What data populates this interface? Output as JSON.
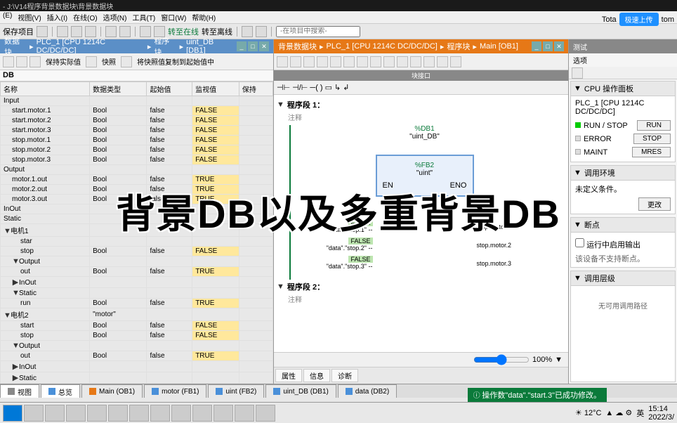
{
  "title": "- J:\\V14程序背景数据块\\背景数据块",
  "menu": [
    "(E)",
    "视图(V)",
    "插入(I)",
    "在线(O)",
    "选项(N)",
    "工具(T)",
    "窗口(W)",
    "帮助(H)"
  ],
  "toolbar": {
    "save": "保存项目",
    "goto_online": "转至在线",
    "goto_offline": "转至离线",
    "search_ph": "-在项目中搜索-"
  },
  "topright": {
    "total": "Tota",
    "cloud": "极速上传",
    "tom": "tom"
  },
  "left": {
    "crumb": [
      "数据块",
      "PLC_1 [CPU 1214C DC/DC/DC]",
      "程序块",
      "uint_DB [DB1]"
    ],
    "tb": {
      "keep": "保持实际值",
      "snap": "快照",
      "copy": "将快照值复制到起始值中"
    },
    "db_name": "DB",
    "cols": [
      "名称",
      "数据类型",
      "起始值",
      "监视值",
      "保持"
    ],
    "rows": [
      {
        "n": "Input",
        "t": "",
        "s": "",
        "m": "",
        "lvl": 0
      },
      {
        "n": "start.motor.1",
        "t": "Bool",
        "s": "false",
        "m": "FALSE",
        "lvl": 1
      },
      {
        "n": "start.motor.2",
        "t": "Bool",
        "s": "false",
        "m": "FALSE",
        "lvl": 1
      },
      {
        "n": "start.motor.3",
        "t": "Bool",
        "s": "false",
        "m": "FALSE",
        "lvl": 1
      },
      {
        "n": "stop.motor.1",
        "t": "Bool",
        "s": "false",
        "m": "FALSE",
        "lvl": 1
      },
      {
        "n": "stop.motor.2",
        "t": "Bool",
        "s": "false",
        "m": "FALSE",
        "lvl": 1
      },
      {
        "n": "stop.motor.3",
        "t": "Bool",
        "s": "false",
        "m": "FALSE",
        "lvl": 1
      },
      {
        "n": "Output",
        "t": "",
        "s": "",
        "m": "",
        "lvl": 0
      },
      {
        "n": "motor.1.out",
        "t": "Bool",
        "s": "false",
        "m": "TRUE",
        "lvl": 1
      },
      {
        "n": "motor.2.out",
        "t": "Bool",
        "s": "false",
        "m": "TRUE",
        "lvl": 1
      },
      {
        "n": "motor.3.out",
        "t": "Bool",
        "s": "false",
        "m": "TRUE",
        "lvl": 1
      },
      {
        "n": "InOut",
        "t": "",
        "s": "",
        "m": "",
        "lvl": 0
      },
      {
        "n": "Static",
        "t": "",
        "s": "",
        "m": "",
        "lvl": 0
      },
      {
        "n": "电机1",
        "t": "",
        "s": "",
        "m": "",
        "lvl": 0,
        "exp": "▼"
      },
      {
        "n": "star",
        "t": "",
        "s": "",
        "m": "",
        "lvl": 2
      },
      {
        "n": "stop",
        "t": "Bool",
        "s": "false",
        "m": "FALSE",
        "lvl": 2
      },
      {
        "n": "Output",
        "t": "",
        "s": "",
        "m": "",
        "lvl": 1,
        "exp": "▼"
      },
      {
        "n": "out",
        "t": "Bool",
        "s": "false",
        "m": "TRUE",
        "lvl": 2
      },
      {
        "n": "InOut",
        "t": "",
        "s": "",
        "m": "",
        "lvl": 1,
        "exp": "▶"
      },
      {
        "n": "Static",
        "t": "",
        "s": "",
        "m": "",
        "lvl": 1,
        "exp": "▼"
      },
      {
        "n": "run",
        "t": "Bool",
        "s": "false",
        "m": "TRUE",
        "lvl": 2
      },
      {
        "n": "电机2",
        "t": "\"motor\"",
        "s": "",
        "m": "",
        "lvl": 0,
        "exp": "▼"
      },
      {
        "n": "start",
        "t": "Bool",
        "s": "false",
        "m": "FALSE",
        "lvl": 2
      },
      {
        "n": "stop",
        "t": "Bool",
        "s": "false",
        "m": "FALSE",
        "lvl": 2
      },
      {
        "n": "Output",
        "t": "",
        "s": "",
        "m": "",
        "lvl": 1,
        "exp": "▼"
      },
      {
        "n": "out",
        "t": "Bool",
        "s": "false",
        "m": "TRUE",
        "lvl": 2
      },
      {
        "n": "InOut",
        "t": "",
        "s": "",
        "m": "",
        "lvl": 1,
        "exp": "▶"
      },
      {
        "n": "Static",
        "t": "",
        "s": "",
        "m": "",
        "lvl": 1,
        "exp": "▶"
      }
    ]
  },
  "mid": {
    "crumb": [
      "背景数据块",
      "PLC_1 [CPU 1214C DC/DC/DC]",
      "程序块",
      "Main [OB1]"
    ],
    "net1": "程序段 1：",
    "net2": "程序段 2：",
    "comment": "注释",
    "db_inst": "%DB1",
    "db_name": "\"uint_DB\"",
    "fb_inst": "%FB2",
    "fb_name": "\"uint\"",
    "en": "EN",
    "eno": "ENO",
    "pins": [
      {
        "l": "\"data\".\"stop.1\"",
        "v": "FALSE",
        "r": "stop.motor.1"
      },
      {
        "l": "\"data\".\"stop.2\"",
        "v": "FALSE",
        "r": "stop.motor.2"
      },
      {
        "l": "\"data\".\"stop.3\"",
        "v": "FALSE",
        "r": "stop.motor.3"
      }
    ],
    "zoom": "100%",
    "prop_tabs": [
      "属性",
      "信息",
      "诊断"
    ],
    "block_if": "块接口"
  },
  "right": {
    "test": "测试",
    "options": "选项",
    "cpu_panel": "CPU 操作面板",
    "plc": "PLC_1 [CPU 1214C DC/DC/DC]",
    "runstop": "RUN / STOP",
    "run_btn": "RUN",
    "error": "ERROR",
    "stop_btn": "STOP",
    "maint": "MAINT",
    "mres_btn": "MRES",
    "callenv": "调用环境",
    "nocond": "未定义条件。",
    "change": "更改",
    "breakpt": "断点",
    "bp_note1": "运行中启用输出",
    "bp_note2": "该设备不支持断点。",
    "callhier": "调用层级",
    "nopath": "无可用调用路径"
  },
  "tabs": [
    {
      "l": "视图",
      "ico": "#888"
    },
    {
      "l": "总览",
      "ico": "#4a90d9"
    },
    {
      "l": "Main (OB1)",
      "ico": "#e67817"
    },
    {
      "l": "motor (FB1)",
      "ico": "#4a90d9"
    },
    {
      "l": "uint (FB2)",
      "ico": "#4a90d9"
    },
    {
      "l": "uint_DB (DB1)",
      "ico": "#4a90d9"
    },
    {
      "l": "data (DB2)",
      "ico": "#4a90d9"
    }
  ],
  "msg": "操作数\"data\".\"start.3\"已成功修改。",
  "tray": {
    "temp": "12°C",
    "lang": "英",
    "time": "15:14",
    "date": "2022/3/"
  },
  "overlay": "背景DB以及多重背景DB"
}
